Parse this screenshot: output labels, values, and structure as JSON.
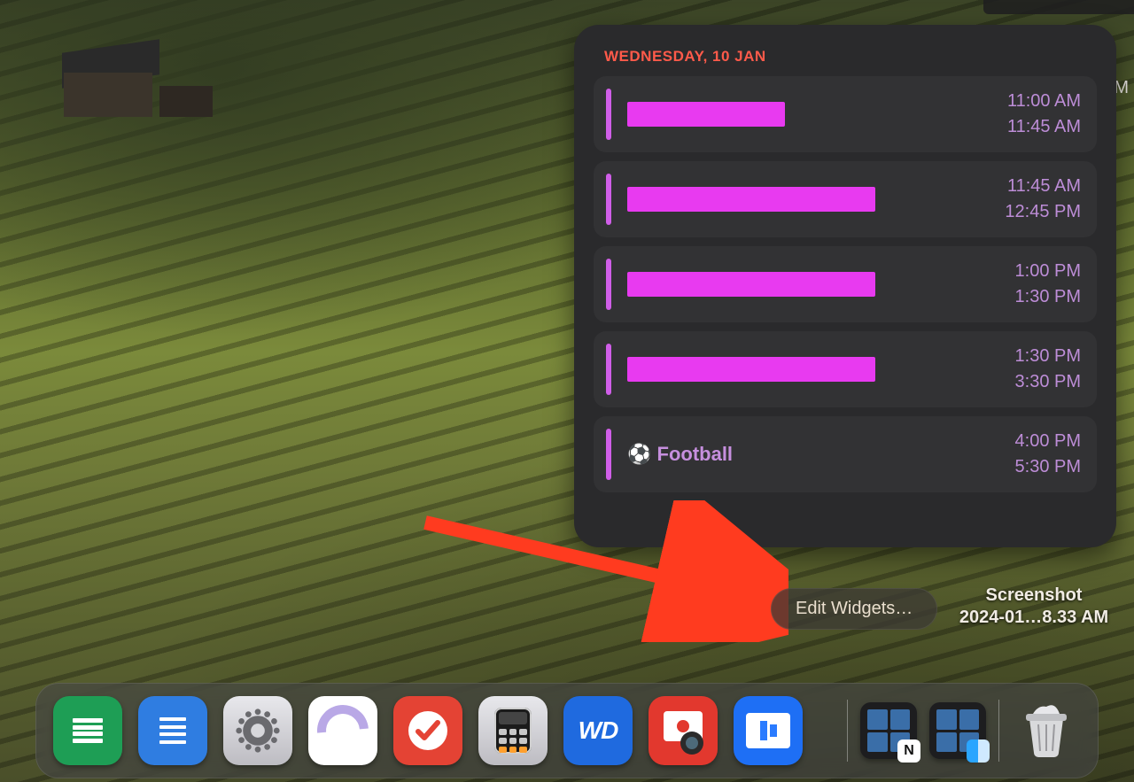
{
  "widget": {
    "date_header": "WEDNESDAY, 10 JAN",
    "events": [
      {
        "title": "",
        "redacted": true,
        "redact_width": 178,
        "start": "11:00 AM",
        "end": "11:45 AM"
      },
      {
        "title": "",
        "redacted": true,
        "redact_width": 280,
        "start": "11:45 AM",
        "end": "12:45 PM"
      },
      {
        "title": "",
        "redacted": true,
        "redact_width": 280,
        "start": "1:00 PM",
        "end": "1:30 PM"
      },
      {
        "title": "",
        "redacted": true,
        "redact_width": 280,
        "start": "1:30 PM",
        "end": "3:30 PM"
      },
      {
        "title": "⚽ Football",
        "redacted": false,
        "redact_width": 0,
        "start": "4:00 PM",
        "end": "5:30 PM"
      }
    ]
  },
  "peek_text": "M",
  "edit_widgets_label": "Edit Widgets…",
  "desktop_file": {
    "line1": "Screenshot",
    "line2": "2024-01…8.33 AM"
  },
  "dock": {
    "apps": [
      {
        "name": "google-sheets",
        "bg": "#1e9e55"
      },
      {
        "name": "google-docs",
        "bg": "#2f7de1"
      },
      {
        "name": "system-settings",
        "bg": "#d7d7db"
      },
      {
        "name": "bittorrent",
        "bg": "#ffffff"
      },
      {
        "name": "todoist",
        "bg": "#e44334"
      },
      {
        "name": "calculator",
        "bg": "#3a3a3c"
      },
      {
        "name": "wd-discovery",
        "bg": "#1f6adf",
        "label": "WD"
      },
      {
        "name": "photo-booth",
        "bg": "#e2382e"
      },
      {
        "name": "keynote",
        "bg": "#1e6ff5"
      }
    ],
    "recent": [
      {
        "name": "window-thumb-notion"
      },
      {
        "name": "window-thumb-finder"
      }
    ],
    "trash": "trash-full"
  }
}
